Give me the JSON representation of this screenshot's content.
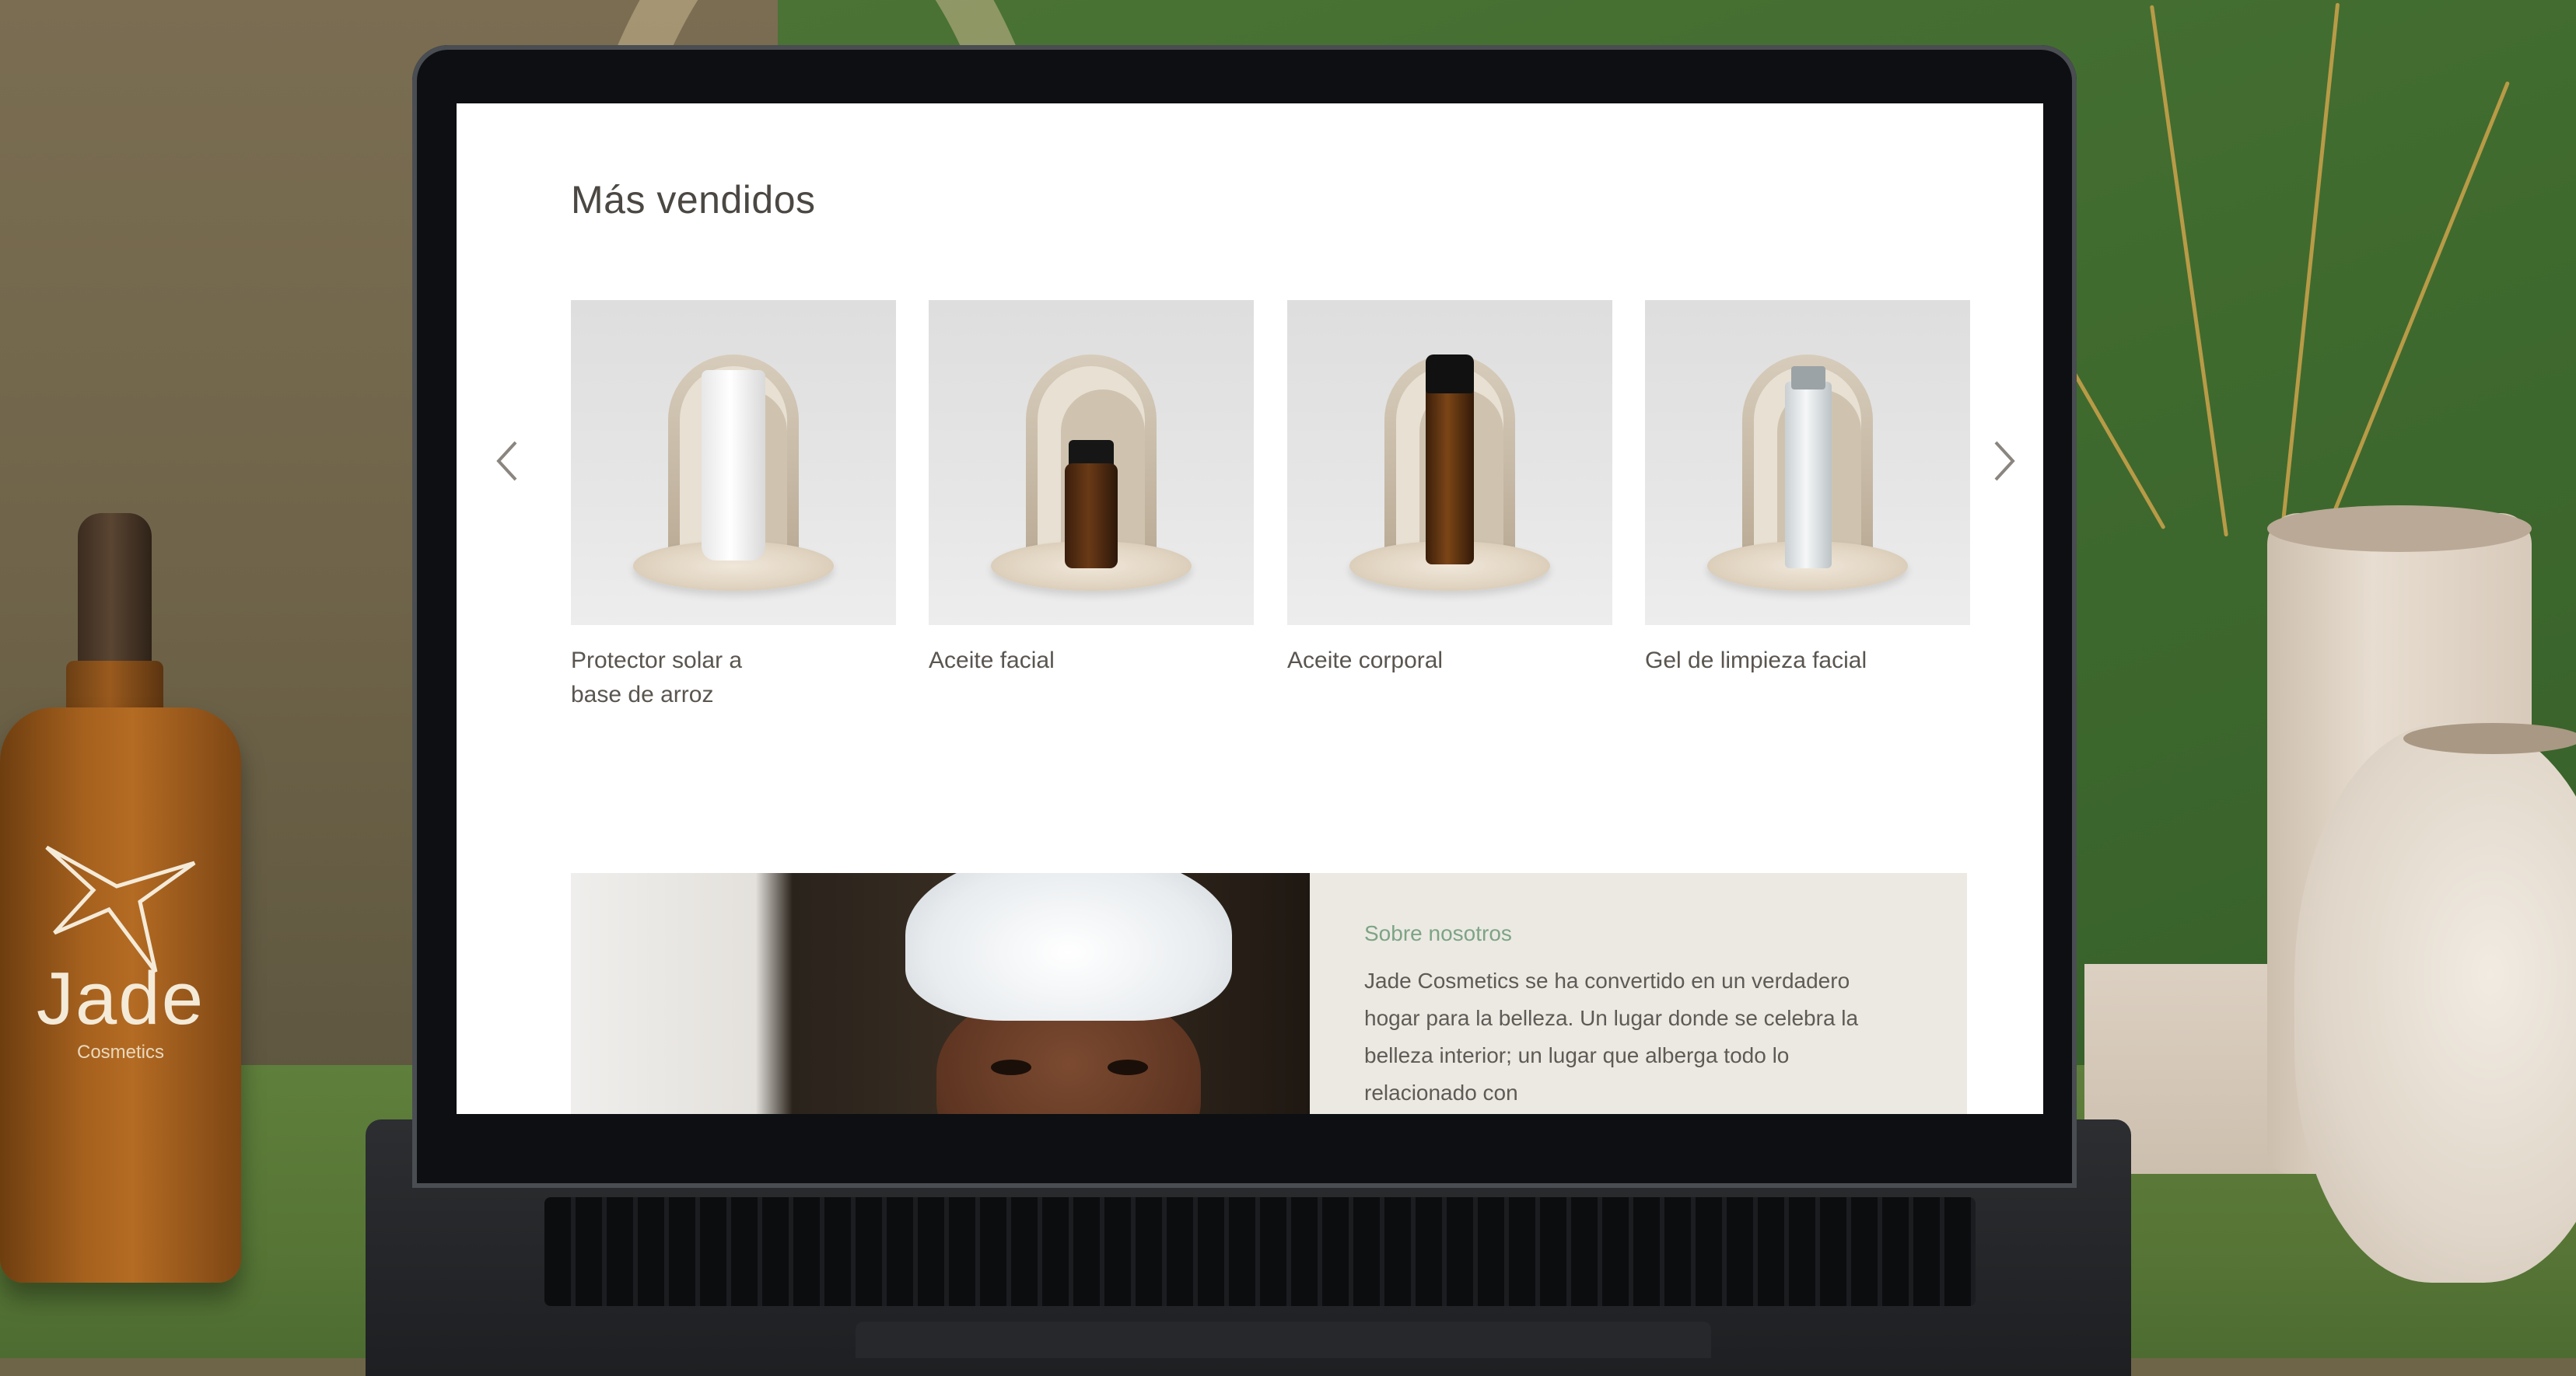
{
  "page": {
    "section_title": "Más vendidos",
    "carousel": {
      "prev_icon": "chevron-left-icon",
      "next_icon": "chevron-right-icon"
    },
    "products": [
      {
        "name": "Protector solar a base de arroz",
        "line1": "Protector solar a",
        "line2": "base de arroz"
      },
      {
        "name": "Aceite facial"
      },
      {
        "name": "Aceite corporal"
      },
      {
        "name": "Gel de limpieza facial"
      }
    ],
    "about": {
      "title": "Sobre nosotros",
      "text": "Jade Cosmetics se ha convertido en un verdadero hogar para la belleza. Un lugar donde se celebra la belleza interior; un lugar que alberga todo lo relacionado con"
    }
  },
  "bottle": {
    "brand": "Jade",
    "subtitle": "Cosmetics"
  },
  "colors": {
    "accent": "#7ca485",
    "text": "#5a554f",
    "panel": "#ece9e3"
  }
}
